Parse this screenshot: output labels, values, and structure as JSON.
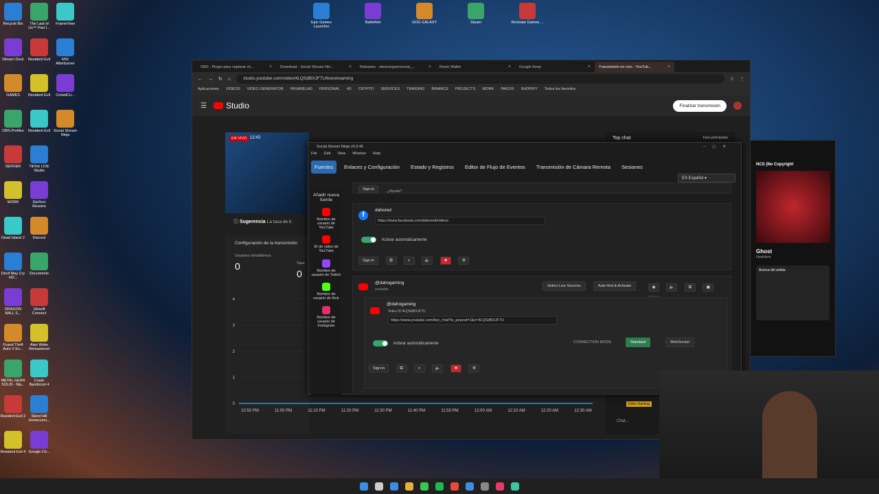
{
  "desktop": {
    "left_col1": [
      "Recycle Bin",
      "Stream Deck",
      "GAMES",
      "OBS Profiles",
      "SERVER",
      "WORK",
      "Dead Island 2",
      "Devil May Cry HD...",
      "DRAGON BALL S...",
      "Grand Theft Auto V En...",
      "METAL GEAR SOLID - Ma...",
      "Resident Evil 2",
      "Resident Evil 4"
    ],
    "left_col2": [
      "The Last of Us™ Part I...",
      "Resident Evil",
      "Resident Evil",
      "Resident Evil",
      "TikTok LIVE Studio",
      "DaVinci Resolve",
      "Discord",
      "Documents",
      "Ubisoft Connect",
      "Alan Wake Remastered",
      "Crash Bandicoot 4",
      "Silent Hill Homecomi...",
      "Google Ch..."
    ],
    "left_col3": [
      "FrameView",
      "MSI Afterburner",
      "CrowdCo...",
      "Social Stream Ninja"
    ],
    "top_icons": [
      "Epic Games Launcher",
      "BattleNet",
      "GOG GALAXY",
      "Steam",
      "Rockstar Games ..."
    ]
  },
  "browser": {
    "tabs": [
      "OBS - Plugin para capturar ch...",
      "Download - Social Stream Nin...",
      "Releases · steveseguin/social_...",
      "Ronin Wallet",
      "Google Keep",
      "Transmisión en vivo - YouTub..."
    ],
    "url": "studio.youtube.com/video/4LQSdBXJF7U/livestreaming",
    "bookmarks": [
      "Aplicaciones",
      "VIDEOS",
      "VIDEO GENERATOR",
      "PASARELAS",
      "PERSONAL",
      "4S",
      "CRYPTO",
      "SERVICES",
      "TRAIDING",
      "BINANCE",
      "PROJECTS",
      "WORK",
      "PAGOS",
      "SHOPIFY",
      "Todos los favoritos"
    ],
    "studio_logo": "Studio",
    "end_button": "Finalizar transmisión",
    "live_badge": "EN VIVO",
    "live_time": "12:43",
    "suggestion_label": "Sugerencia",
    "suggestion_text": "La tasa de b",
    "config_label": "Configuración de la transmisión",
    "concurrent_label": "Usuarios simultáneos",
    "concurrent_value": "0",
    "rate_label": "Tasa",
    "rate_value": "0",
    "chart_data": {
      "type": "line",
      "categories": [
        "10:50 PM",
        "11:00 PM",
        "11:10 PM",
        "11:20 PM",
        "11:30 PM",
        "11:40 PM",
        "11:50 PM",
        "12:00 AM",
        "12:10 AM",
        "12:20 AM",
        "12:30 AM"
      ],
      "ytick_labels": [
        "0",
        "1",
        "2",
        "3",
        "4"
      ],
      "ylim": [
        0,
        4
      ]
    },
    "chat_title": "Top chat",
    "chat_fans": "Fans principales",
    "chat_user": "Daho Gaming",
    "chat_input": "Chat..."
  },
  "ssn": {
    "title": "Social Stream Ninja v0.3.46",
    "menu": [
      "File",
      "Edit",
      "View",
      "Window",
      "Help"
    ],
    "tabs": [
      "Fuentes",
      "Enlaces y Configuración",
      "Estado y Registros",
      "Editor de Flujo de Eventos",
      "Transmisión de Cámara Remota",
      "Sesiones"
    ],
    "language": "Español",
    "sidebar": {
      "add_source": "Añadir nueva fuente",
      "items": [
        "Nombre de usuario de YouTube",
        "ID de video de YouTube",
        "Nombre de usuario de Twitch",
        "Nombre de usuario de Kick",
        "Nombre de usuario de Instagram"
      ]
    },
    "top_strip": {
      "signin": "Sign-in",
      "help": "¿Ayuda?"
    },
    "facebook": {
      "name": "dahored",
      "url": "https://www.facebook.com/dahored/videos",
      "auto_label": "Activar automáticamente",
      "signin": "Sign-in"
    },
    "youtube": {
      "name": "@dahogaming",
      "platform": "youtube",
      "select_live": "Select Live Sources",
      "auto_find": "Auto-find & Activate",
      "inner_name": "@dahogaming",
      "video_id_label": "Video ID",
      "video_id": "4LQSdBXJF7U",
      "url": "https://www.youtube.com/live_chat?is_popout=1&v=4LQSdBXJF7U",
      "auto_label": "Activar automáticamente",
      "connection_label": "CONNECTION MODE:",
      "mode_standard": "Standard",
      "mode_websocket": "WebSocket",
      "signin": "Sign-in"
    }
  },
  "spotify": {
    "playlist": "NCS (No Copyright",
    "track": "Ghost",
    "artist": "Hedclem",
    "about": "Acerca del artista"
  },
  "colors": {
    "accent": "#2b6cb0",
    "toggle": "#3aa56a",
    "yt_red": "#ff0000",
    "standard_btn": "#2e7d4f"
  }
}
